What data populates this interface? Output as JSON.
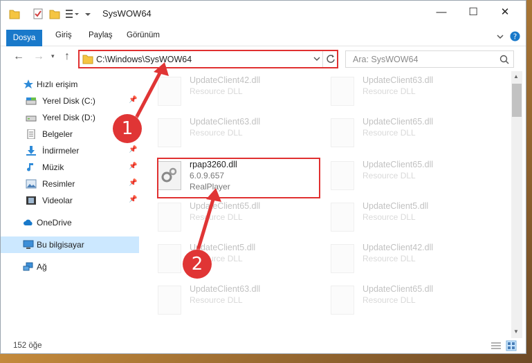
{
  "window": {
    "title": "SysWOW64",
    "controls": {
      "minimize": "—",
      "maximize": "☐",
      "close": "✕"
    }
  },
  "ribbon": {
    "tabs": [
      "Dosya",
      "Giriş",
      "Paylaş",
      "Görünüm"
    ]
  },
  "nav": {
    "address": "C:\\Windows\\SysWOW64",
    "search_placeholder": "Ara: SysWOW64"
  },
  "sidebar": {
    "quick_access": "Hızlı erişim",
    "items": [
      {
        "label": "Yerel Disk (C:)",
        "icon": "drive-icon",
        "pinned": true
      },
      {
        "label": "Yerel Disk (D:)",
        "icon": "drive-icon",
        "pinned": false
      },
      {
        "label": "Belgeler",
        "icon": "documents-icon",
        "pinned": true
      },
      {
        "label": "İndirmeler",
        "icon": "downloads-icon",
        "pinned": true
      },
      {
        "label": "Müzik",
        "icon": "music-icon",
        "pinned": true
      },
      {
        "label": "Resimler",
        "icon": "pictures-icon",
        "pinned": true
      },
      {
        "label": "Videolar",
        "icon": "videos-icon",
        "pinned": true
      }
    ],
    "onedrive": "OneDrive",
    "this_pc": "Bu bilgisayar",
    "network": "Ağ"
  },
  "files": {
    "left": [
      {
        "name": "UpdateClient42.dll",
        "desc": "Resource DLL"
      },
      {
        "name": "UpdateClient63.dll",
        "desc": "Resource DLL"
      },
      {
        "name": "rpap3260.dll",
        "desc": "6.0.9.657",
        "desc2": "RealPlayer"
      },
      {
        "name": "UpdateClient65.dll",
        "desc": "Resource DLL"
      },
      {
        "name": "UpdateClient5.dll",
        "desc": "Resource DLL"
      },
      {
        "name": "UpdateClient63.dll",
        "desc": "Resource DLL"
      }
    ],
    "right": [
      {
        "name": "UpdateClient63.dll",
        "desc": "Resource DLL"
      },
      {
        "name": "UpdateClient65.dll",
        "desc": "Resource DLL"
      },
      {
        "name": "UpdateClient65.dll",
        "desc": "Resource DLL"
      },
      {
        "name": "UpdateClient5.dll",
        "desc": "Resource DLL"
      },
      {
        "name": "UpdateClient42.dll",
        "desc": "Resource DLL"
      },
      {
        "name": "UpdateClient65.dll",
        "desc": "Resource DLL"
      }
    ]
  },
  "status": {
    "item_count": "152 öğe"
  },
  "callouts": {
    "one": "1",
    "two": "2"
  },
  "colors": {
    "accent": "#1979ca",
    "highlight": "#e03030",
    "selected": "#cce8ff"
  }
}
